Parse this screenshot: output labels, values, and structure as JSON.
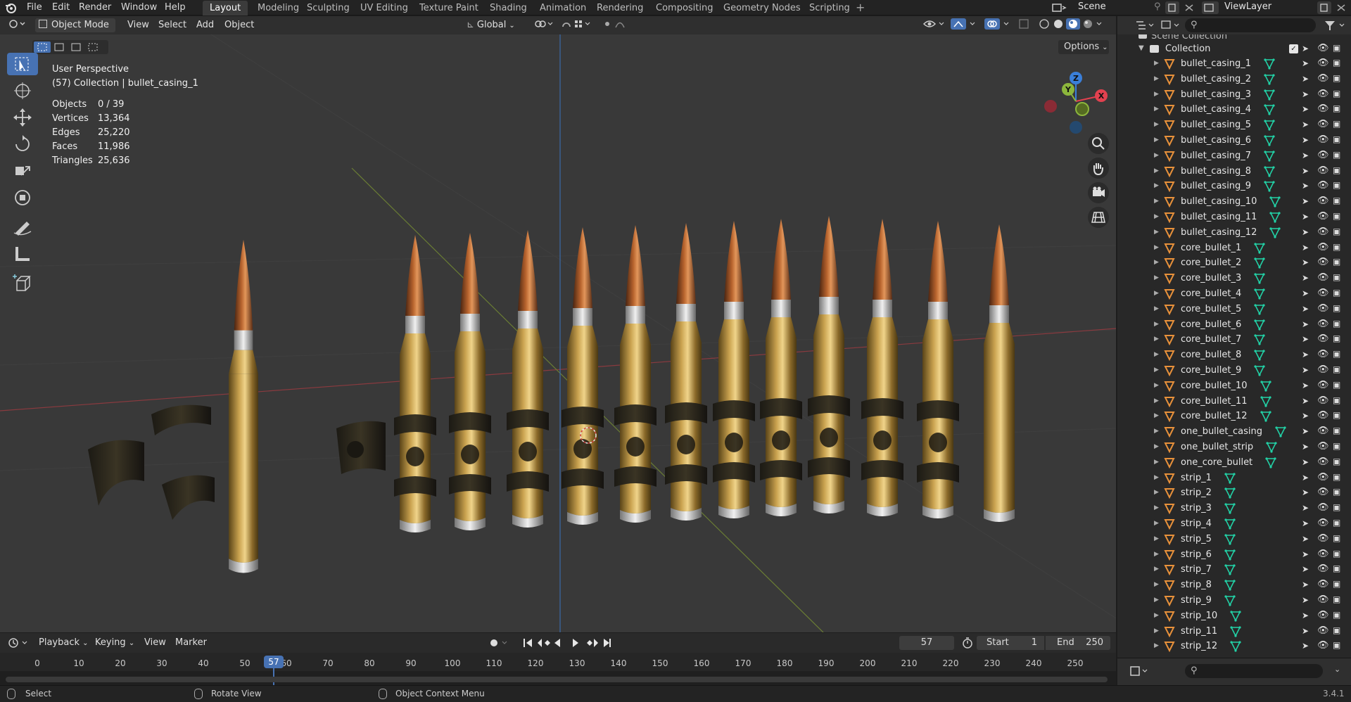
{
  "menu": {
    "file": "File",
    "edit": "Edit",
    "render": "Render",
    "window": "Window",
    "help": "Help"
  },
  "workspaces": [
    "Layout",
    "Modeling",
    "Sculpting",
    "UV Editing",
    "Texture Paint",
    "Shading",
    "Animation",
    "Rendering",
    "Compositing",
    "Geometry Nodes",
    "Scripting"
  ],
  "active_workspace": "Layout",
  "scene_name": "Scene",
  "view_layer": "ViewLayer",
  "viewport_header": {
    "mode": "Object Mode",
    "view": "View",
    "select": "Select",
    "add": "Add",
    "object": "Object",
    "orientation": "Global",
    "options": "Options"
  },
  "overlay_text": {
    "perspective": "User Perspective",
    "collection": "(57) Collection | bullet_casing_1"
  },
  "stats": [
    {
      "label": "Objects",
      "value": "0 / 39"
    },
    {
      "label": "Vertices",
      "value": "13,364"
    },
    {
      "label": "Edges",
      "value": "25,220"
    },
    {
      "label": "Faces",
      "value": "11,986"
    },
    {
      "label": "Triangles",
      "value": "25,636"
    }
  ],
  "gizmo": {
    "z": "Z",
    "y": "Y",
    "x": "X"
  },
  "outliner": {
    "scene_collection": "Scene Collection",
    "collection": "Collection",
    "items": [
      "bullet_casing_1",
      "bullet_casing_2",
      "bullet_casing_3",
      "bullet_casing_4",
      "bullet_casing_5",
      "bullet_casing_6",
      "bullet_casing_7",
      "bullet_casing_8",
      "bullet_casing_9",
      "bullet_casing_10",
      "bullet_casing_11",
      "bullet_casing_12",
      "core_bullet_1",
      "core_bullet_2",
      "core_bullet_3",
      "core_bullet_4",
      "core_bullet_5",
      "core_bullet_6",
      "core_bullet_7",
      "core_bullet_8",
      "core_bullet_9",
      "core_bullet_10",
      "core_bullet_11",
      "core_bullet_12",
      "one_bullet_casing",
      "one_bullet_strip",
      "one_core_bullet",
      "strip_1",
      "strip_2",
      "strip_3",
      "strip_4",
      "strip_5",
      "strip_6",
      "strip_7",
      "strip_8",
      "strip_9",
      "strip_10",
      "strip_11",
      "strip_12"
    ]
  },
  "timeline": {
    "playback": "Playback",
    "keying": "Keying",
    "view": "View",
    "marker": "Marker",
    "current_frame": "57",
    "start_label": "Start",
    "start": "1",
    "end_label": "End",
    "end": "250",
    "ticks": [
      "0",
      "10",
      "20",
      "30",
      "40",
      "50",
      "60",
      "70",
      "80",
      "90",
      "100",
      "110",
      "120",
      "130",
      "140",
      "150",
      "160",
      "170",
      "180",
      "190",
      "200",
      "210",
      "220",
      "230",
      "240",
      "250"
    ]
  },
  "status": {
    "select": "Select",
    "rotate": "Rotate View",
    "context": "Object Context Menu",
    "version": "3.4.1"
  },
  "colors": {
    "accent": "#4772b3",
    "x_axis": "#e2414f",
    "y_axis": "#8cb63c",
    "z_axis": "#3a7fd9",
    "mesh_icon": "#e8913b",
    "data_icon": "#22d1a6"
  }
}
